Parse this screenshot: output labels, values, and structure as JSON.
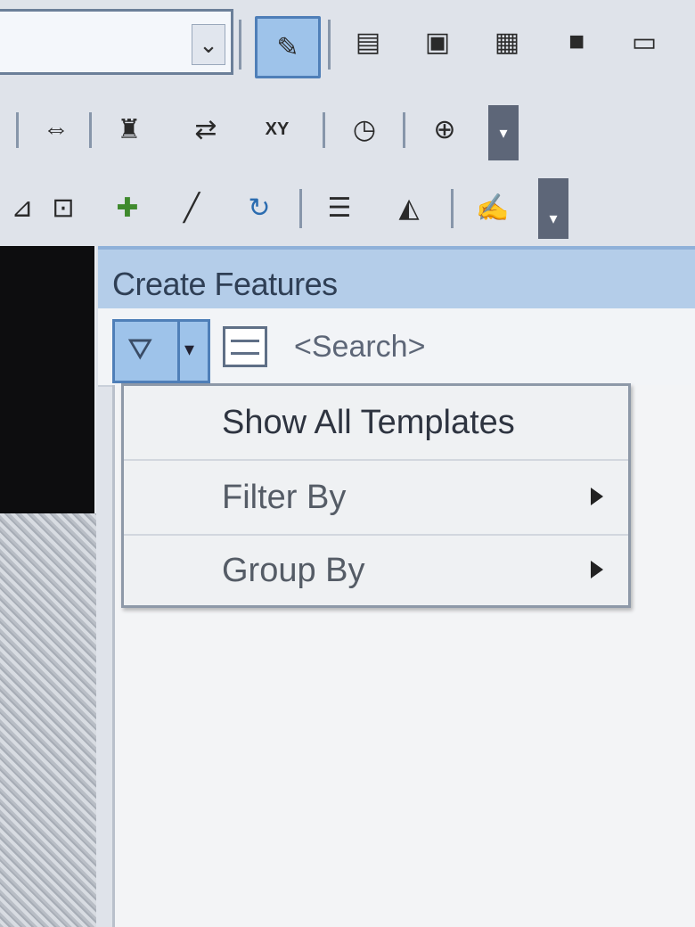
{
  "toolbar": {
    "row1": [
      "dropdown-arrow",
      "edit-tool-icon",
      "attributes-icon",
      "map-icon",
      "layer-icon",
      "server-icon",
      "command-icon"
    ],
    "row2": [
      "measure-icon",
      "find-icon",
      "go-to-xy-icon",
      "xy-icon",
      "time-slider-icon",
      "magnifier-icon"
    ],
    "row3": [
      "vertex-icon",
      "split-icon",
      "cut-icon",
      "rotate-icon",
      "attribute-table-icon",
      "sketch-icon",
      "edit-attributes-icon"
    ],
    "xy_label": "XY"
  },
  "panel": {
    "title": "Create Features",
    "search_placeholder": "<Search>"
  },
  "menu": {
    "items": [
      {
        "label": "Show All Templates",
        "has_submenu": false
      },
      {
        "label": "Filter By",
        "has_submenu": true
      },
      {
        "label": "Group By",
        "has_submenu": true
      }
    ]
  },
  "colors": {
    "header": "#b4cde9",
    "pressed": "#9ec3ea",
    "accent": "#4f7fb8"
  }
}
